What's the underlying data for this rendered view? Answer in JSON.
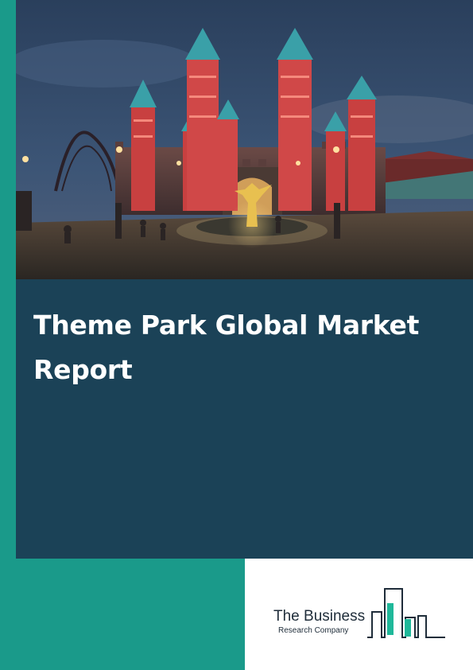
{
  "report": {
    "title": "Theme Park Global Market Report"
  },
  "publisher": {
    "name_line1": "The Business",
    "name_line2": "Research Company"
  },
  "colors": {
    "teal_accent": "#1a9a8a",
    "title_panel": "#1b4257",
    "title_text": "#ffffff",
    "logo_text": "#1f2d3a"
  }
}
